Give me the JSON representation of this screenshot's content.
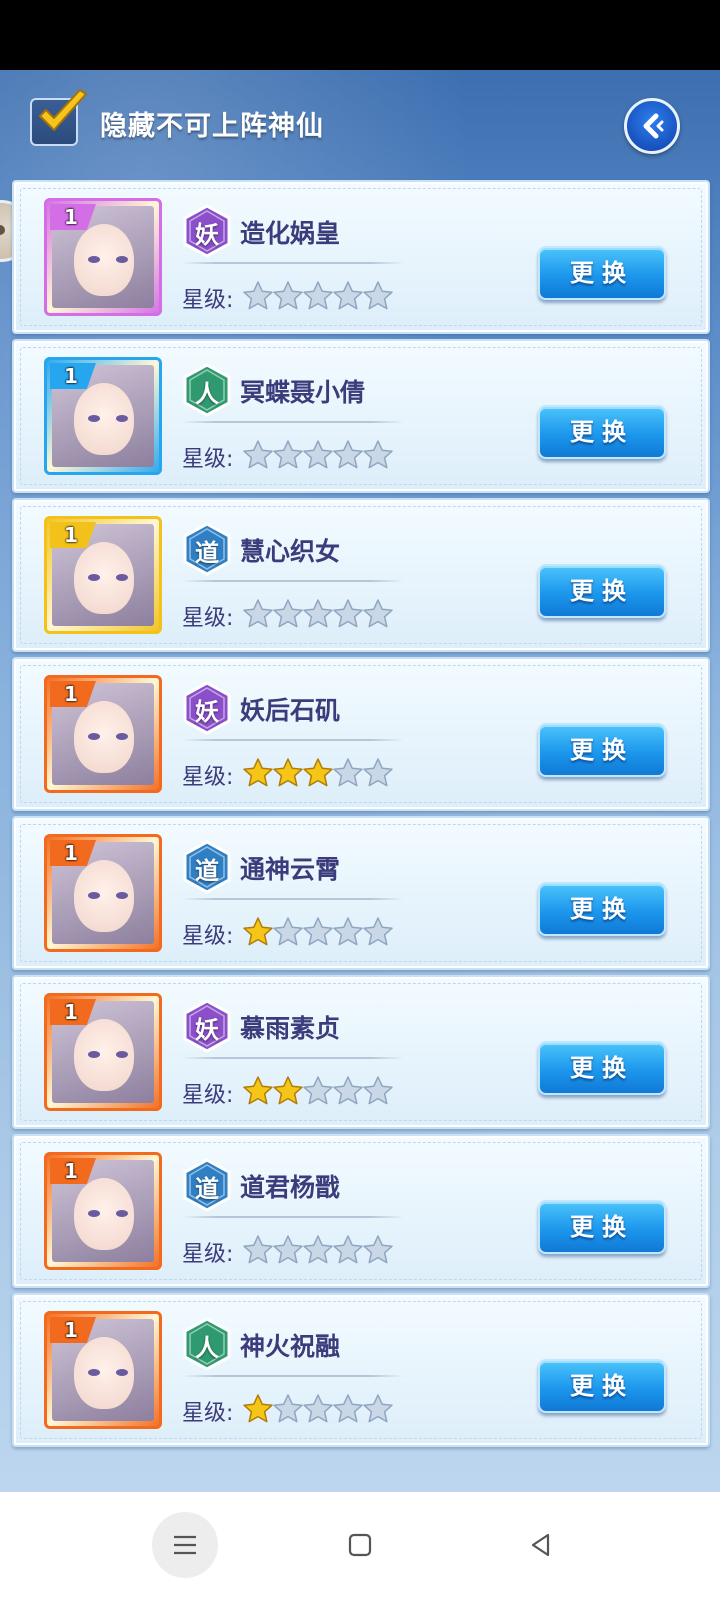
{
  "header": {
    "hide_label": "隐藏不可上阵神仙",
    "hide_checked": true
  },
  "star_label": "星级:",
  "swap_label": "更换",
  "heroes": [
    {
      "level": "1",
      "faction": "妖",
      "name": "造化娲皇",
      "stars": 0,
      "frame": "purple"
    },
    {
      "level": "1",
      "faction": "人",
      "name": "冥蝶聂小倩",
      "stars": 0,
      "frame": "blue"
    },
    {
      "level": "1",
      "faction": "道",
      "name": "慧心织女",
      "stars": 0,
      "frame": "gold"
    },
    {
      "level": "1",
      "faction": "妖",
      "name": "妖后石矶",
      "stars": 3,
      "frame": "orange"
    },
    {
      "level": "1",
      "faction": "道",
      "name": "通神云霄",
      "stars": 1,
      "frame": "orange"
    },
    {
      "level": "1",
      "faction": "妖",
      "name": "慕雨素贞",
      "stars": 2,
      "frame": "orange"
    },
    {
      "level": "1",
      "faction": "道",
      "name": "道君杨戬",
      "stars": 0,
      "frame": "orange"
    },
    {
      "level": "1",
      "faction": "人",
      "name": "神火祝融",
      "stars": 1,
      "frame": "orange"
    }
  ],
  "max_stars": 5,
  "colors": {
    "faction_妖": "#8a4fc9",
    "faction_人": "#2f9a6f",
    "faction_道": "#2f7fc4",
    "frame_purple": "#d36ee6",
    "frame_blue": "#27a6f0",
    "frame_gold": "#f2c21b",
    "frame_orange": "#f26a1d",
    "star_filled": "#f5c518",
    "star_empty": "#c9d7e6"
  }
}
